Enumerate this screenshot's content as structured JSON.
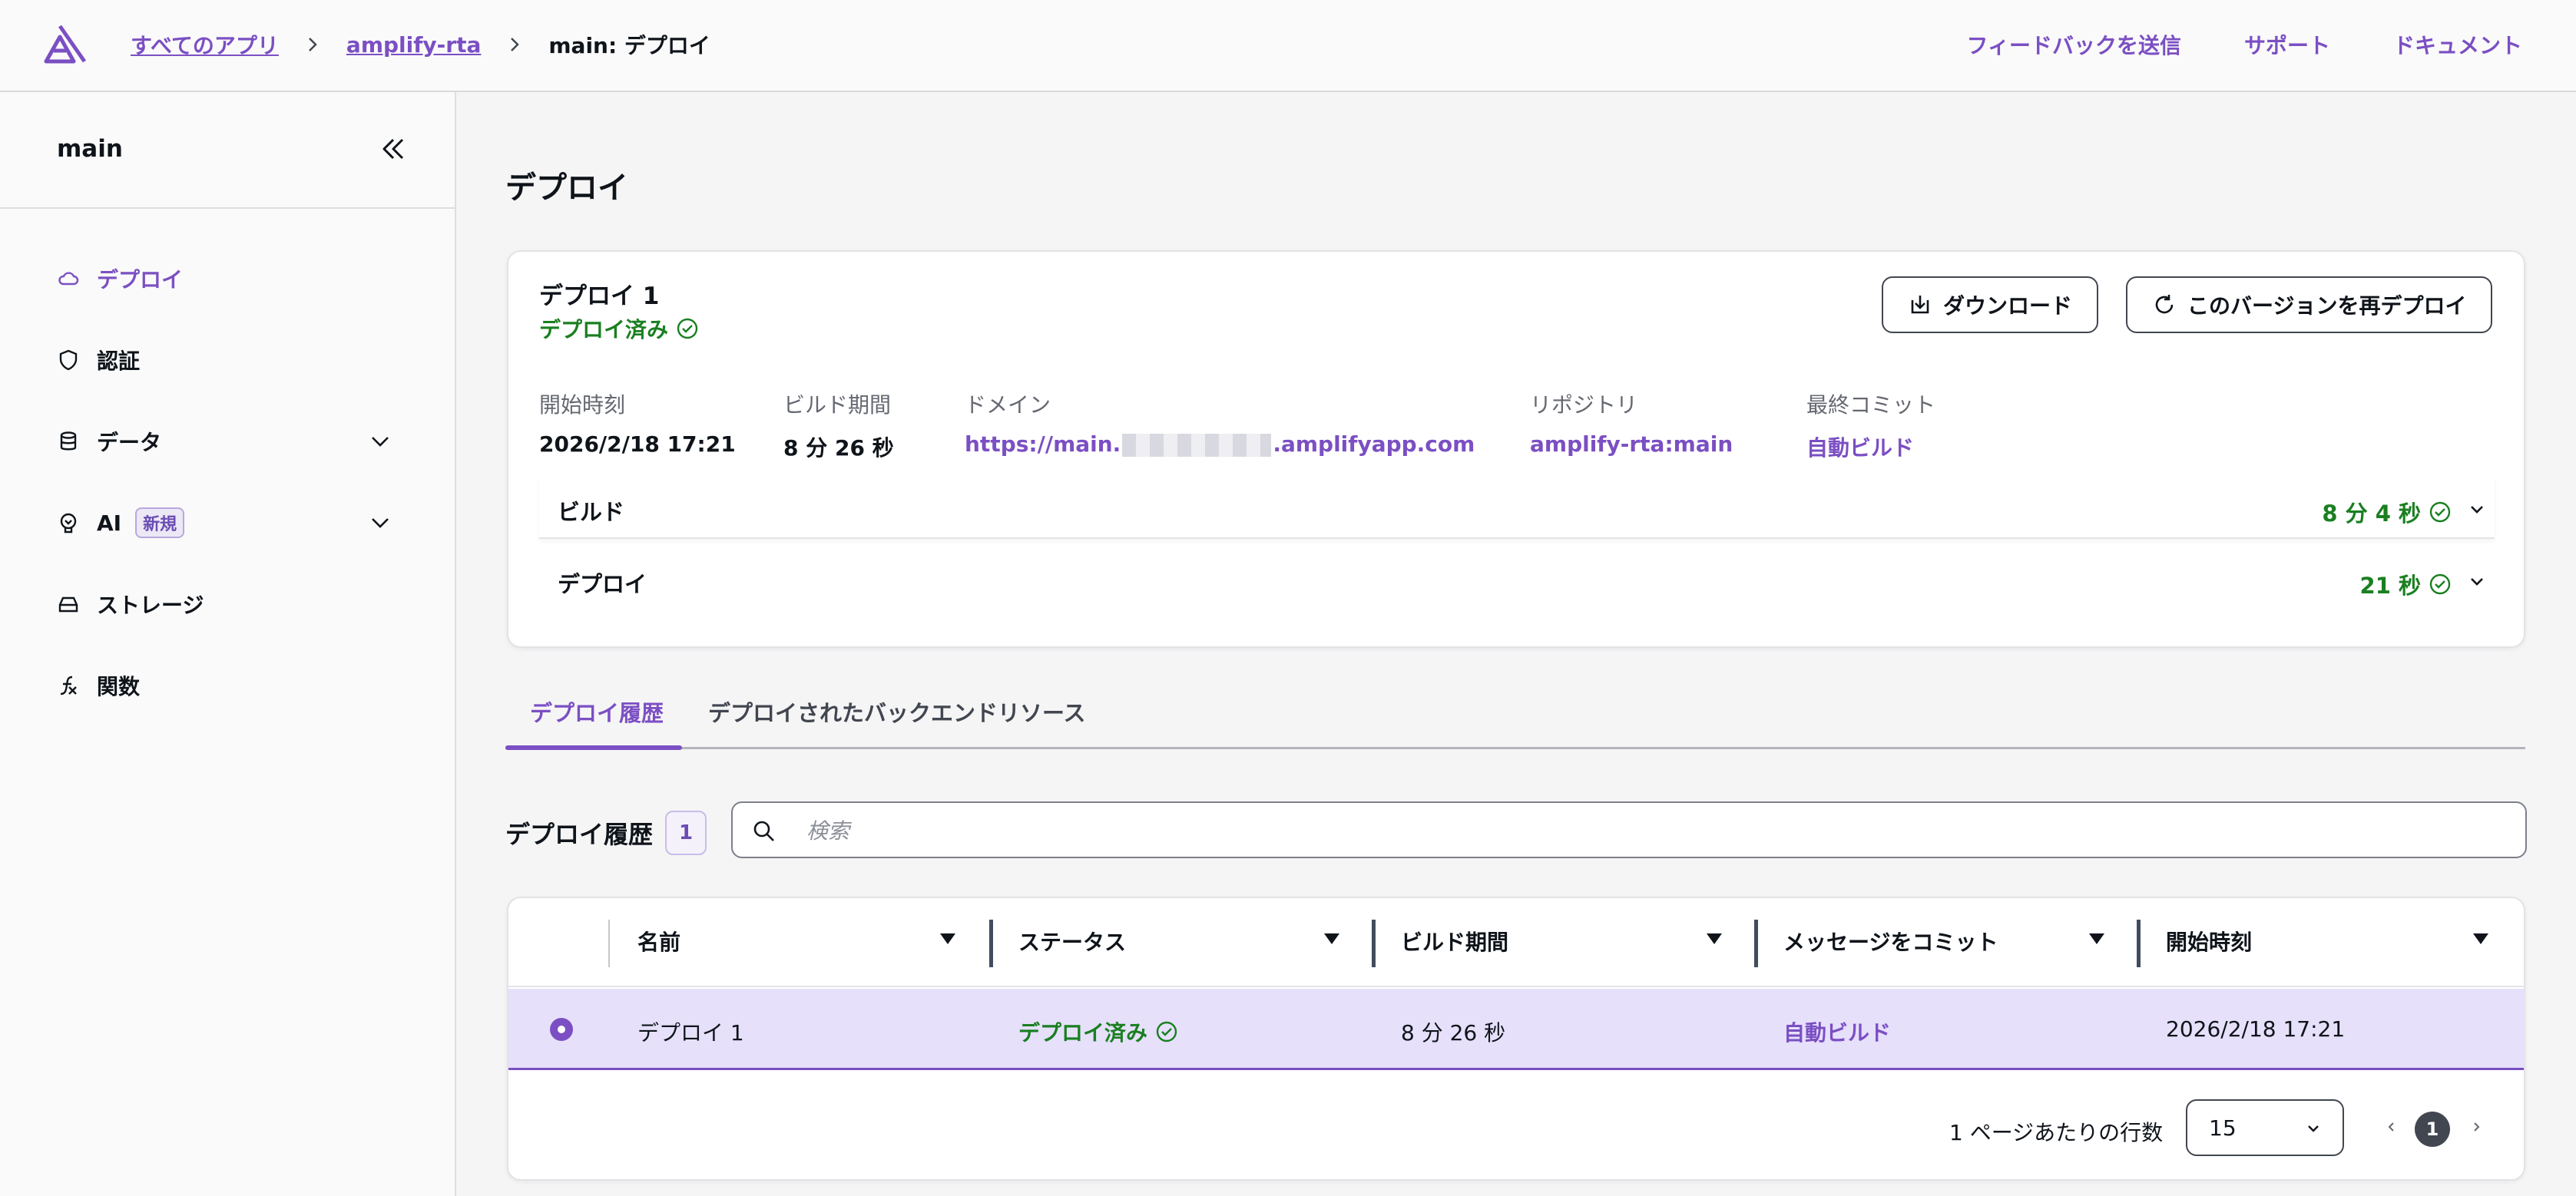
{
  "breadcrumb": {
    "items": [
      "すべてのアプリ",
      "amplify-rta"
    ],
    "current": "main: デプロイ"
  },
  "top_links": [
    "フィードバックを送信",
    "サポート",
    "ドキュメント"
  ],
  "sidebar": {
    "title": "main",
    "items": [
      {
        "label": "デプロイ",
        "icon": "cloud-icon",
        "active": true
      },
      {
        "label": "認証",
        "icon": "shield-icon"
      },
      {
        "label": "データ",
        "icon": "database-icon",
        "expandable": true
      },
      {
        "label": "AI",
        "icon": "brain-icon",
        "badge": "新規",
        "expandable": true
      },
      {
        "label": "ストレージ",
        "icon": "storage-icon"
      },
      {
        "label": "関数",
        "icon": "function-icon"
      }
    ]
  },
  "page": {
    "title": "デプロイ"
  },
  "deployment_card": {
    "title": "デプロイ 1",
    "status": "デプロイ済み",
    "download_label": "ダウンロード",
    "redeploy_label": "このバージョンを再デプロイ",
    "meta": {
      "start_label": "開始時刻",
      "start_value": "2026/2/18 17:21",
      "build_label": "ビルド期間",
      "build_value": "8 分 26 秒",
      "domain_label": "ドメイン",
      "domain_prefix": "https://main.",
      "domain_suffix": ".amplifyapp.com",
      "repo_label": "リポジトリ",
      "repo_value": "amplify-rta:main",
      "commit_label": "最終コミット",
      "commit_value": "自動ビルド"
    },
    "steps": [
      {
        "name": "ビルド",
        "duration": "8 分 4 秒"
      },
      {
        "name": "デプロイ",
        "duration": "21 秒"
      }
    ]
  },
  "tabs": [
    "デプロイ履歴",
    "デプロイされたバックエンドリソース"
  ],
  "history": {
    "title": "デプロイ履歴",
    "count": "1",
    "search_placeholder": "検索",
    "columns": [
      "名前",
      "ステータス",
      "ビルド期間",
      "メッセージをコミット",
      "開始時刻"
    ],
    "rows": [
      {
        "name": "デプロイ 1",
        "status": "デプロイ済み",
        "build": "8 分 26 秒",
        "commit": "自動ビルド",
        "start": "2026/2/18 17:21"
      }
    ],
    "rows_per_page_label": "1 ページあたりの行数",
    "rows_per_page": "15",
    "current_page": "1"
  },
  "colors": {
    "accent": "#7b4fc3",
    "success": "#1a7f20",
    "selected_row": "#e6e0fb"
  }
}
